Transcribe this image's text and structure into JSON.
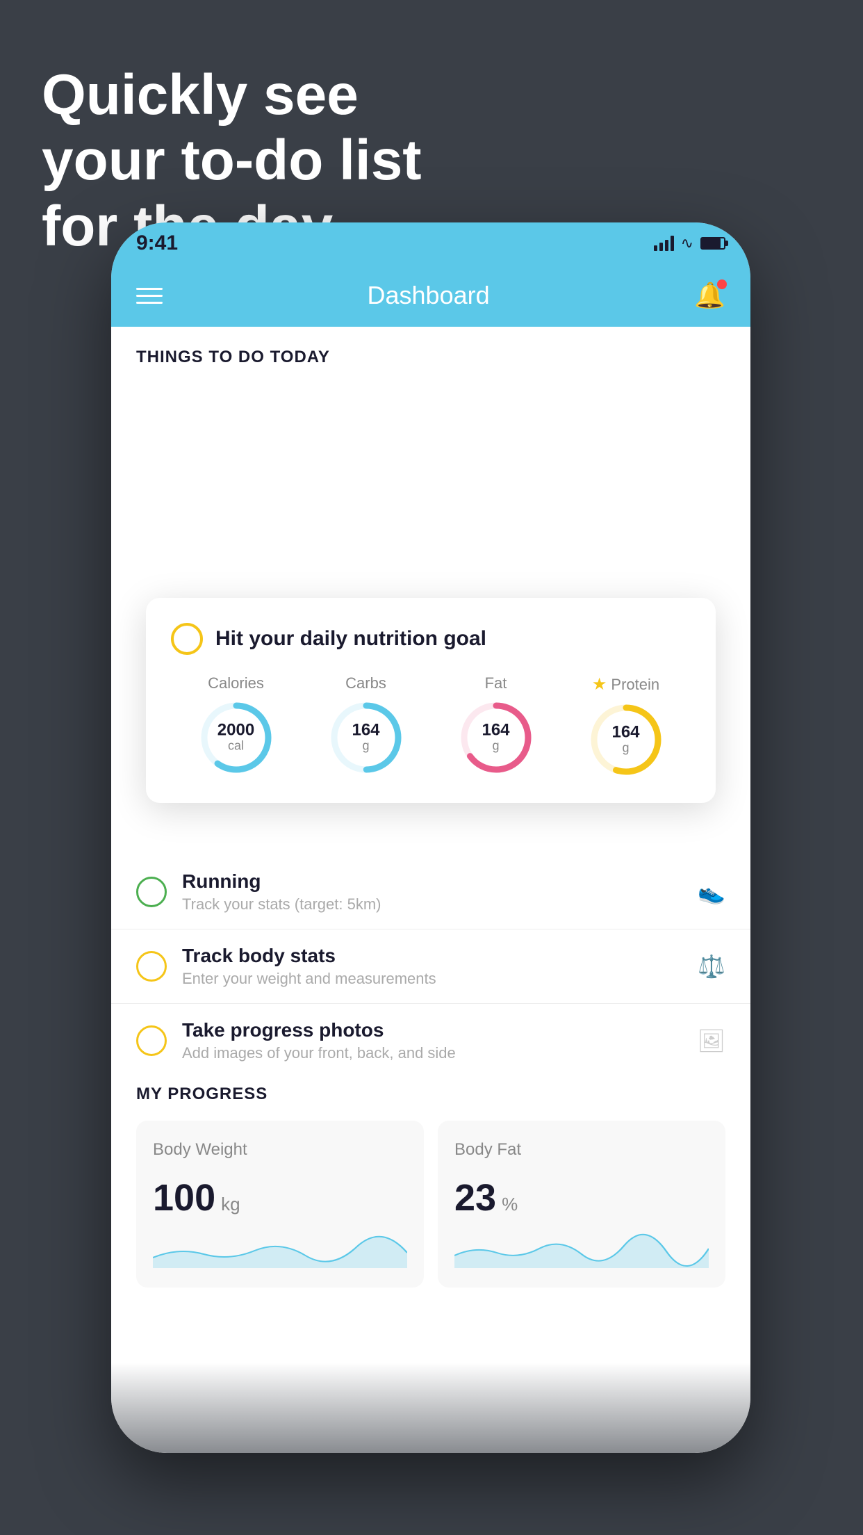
{
  "headline": {
    "line1": "Quickly see",
    "line2": "your to-do list",
    "line3": "for the day."
  },
  "status_bar": {
    "time": "9:41"
  },
  "header": {
    "title": "Dashboard"
  },
  "things_section": {
    "title": "THINGS TO DO TODAY"
  },
  "nutrition_card": {
    "check_label": "",
    "title": "Hit your daily nutrition goal",
    "items": [
      {
        "label": "Calories",
        "value": "2000",
        "unit": "cal",
        "color": "#5bc8e8",
        "has_star": false,
        "percent": 60
      },
      {
        "label": "Carbs",
        "value": "164",
        "unit": "g",
        "color": "#5bc8e8",
        "has_star": false,
        "percent": 50
      },
      {
        "label": "Fat",
        "value": "164",
        "unit": "g",
        "color": "#e85b8a",
        "has_star": false,
        "percent": 65
      },
      {
        "label": "Protein",
        "value": "164",
        "unit": "g",
        "color": "#f5c518",
        "has_star": true,
        "percent": 55
      }
    ]
  },
  "todo_items": [
    {
      "title": "Running",
      "subtitle": "Track your stats (target: 5km)",
      "circle_color": "green",
      "icon": "👟"
    },
    {
      "title": "Track body stats",
      "subtitle": "Enter your weight and measurements",
      "circle_color": "yellow",
      "icon": "⚖️"
    },
    {
      "title": "Take progress photos",
      "subtitle": "Add images of your front, back, and side",
      "circle_color": "yellow",
      "icon": "🖼️"
    }
  ],
  "progress_section": {
    "title": "MY PROGRESS",
    "cards": [
      {
        "title": "Body Weight",
        "value": "100",
        "unit": "kg"
      },
      {
        "title": "Body Fat",
        "value": "23",
        "unit": "%"
      }
    ]
  }
}
